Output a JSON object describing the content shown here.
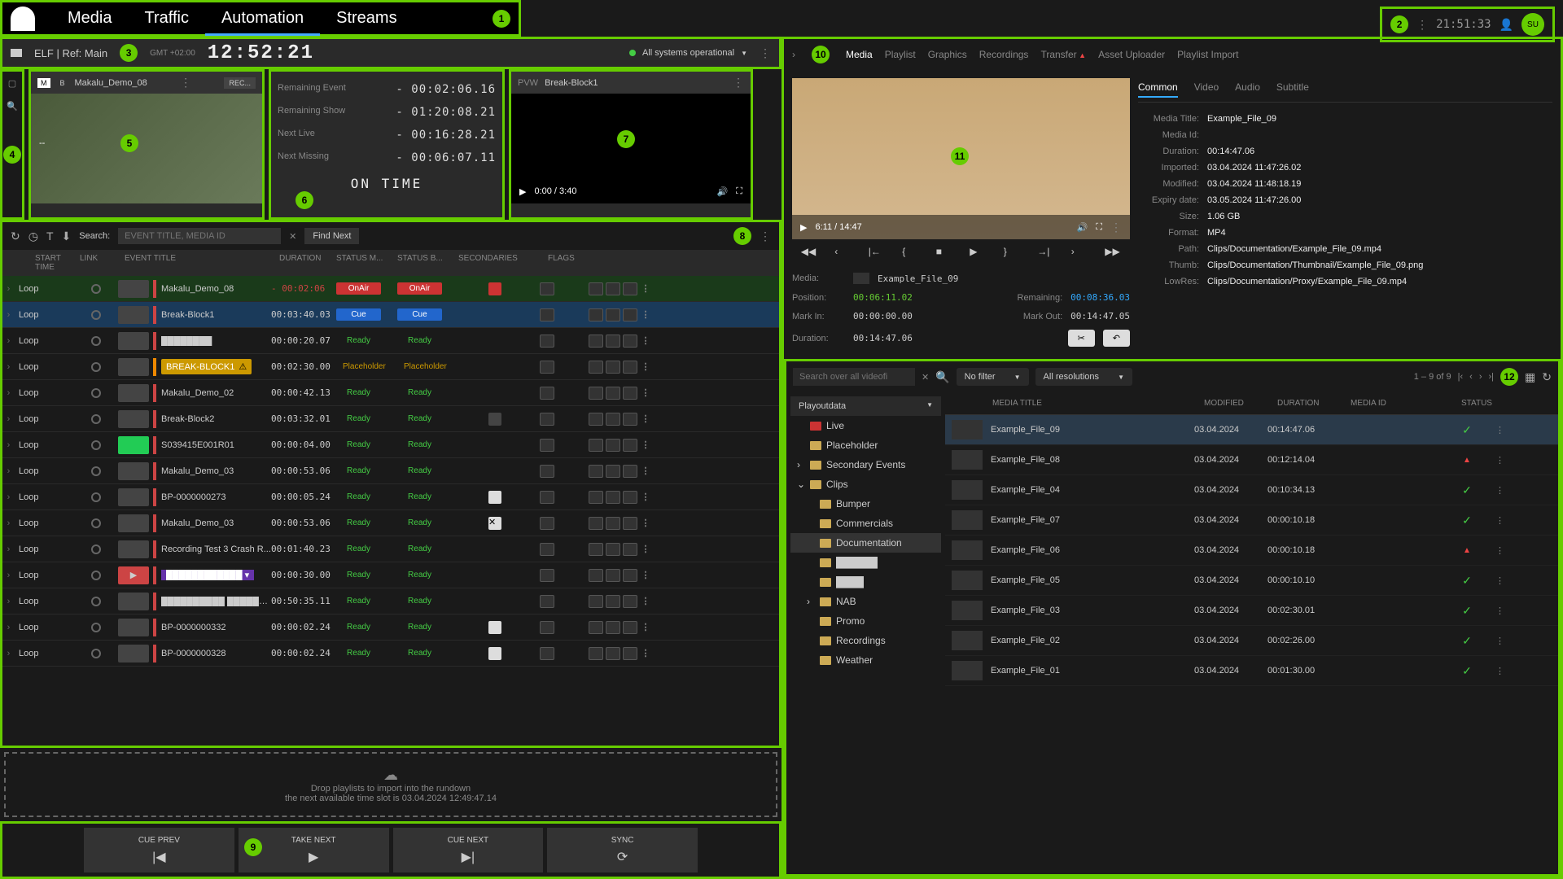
{
  "nav": {
    "items": [
      "Media",
      "Traffic",
      "Automation",
      "Streams"
    ],
    "active": 2
  },
  "topRight": {
    "time": "21:51:33",
    "avatar": "SU"
  },
  "statusBar": {
    "channel": "ELF | Ref: Main",
    "tz": "GMT +02:00",
    "clock": "12:52:21",
    "systemStatus": "All systems operational"
  },
  "pgm": {
    "badge1": "M",
    "badge2": "B",
    "title": "Makalu_Demo_08",
    "rec": "REC..."
  },
  "timing": {
    "rows": [
      {
        "label": "Remaining Event",
        "val": "- 00:02:06.16"
      },
      {
        "label": "Remaining Show",
        "val": "- 01:20:08.21"
      },
      {
        "label": "Next Live",
        "val": "- 00:16:28.21"
      },
      {
        "label": "Next Missing",
        "val": "- 00:06:07.11"
      }
    ],
    "onTime": "ON TIME"
  },
  "pvw": {
    "label": "PVW",
    "title": "Break-Block1",
    "time": "0:00 / 3:40"
  },
  "rundown": {
    "searchLabel": "Search:",
    "searchPlaceholder": "EVENT TITLE, MEDIA ID",
    "findNext": "Find Next",
    "headers": {
      "start": "START TIME",
      "link": "LINK",
      "title": "EVENT TITLE",
      "dur": "DURATION",
      "statusm": "STATUS M...",
      "statusb": "STATUS B...",
      "sec": "SECONDARIES",
      "flags": "FLAGS"
    },
    "rows": [
      {
        "start": "Loop",
        "title": "Makalu_Demo_08",
        "dur": "- 00:02:06",
        "m": "OnAir",
        "b": "OnAir",
        "state": "onair",
        "secRed": true
      },
      {
        "start": "Loop",
        "title": "Break-Block1",
        "dur": "00:03:40.03",
        "m": "Cue",
        "b": "Cue",
        "state": "cue"
      },
      {
        "start": "Loop",
        "title": "████████",
        "dur": "00:00:20.07",
        "m": "Ready",
        "b": "Ready",
        "state": ""
      },
      {
        "start": "Loop",
        "title": "BREAK-BLOCK1",
        "dur": "00:02:30.00",
        "m": "Placeholder",
        "b": "Placeholder",
        "state": "placeholder",
        "warn": true
      },
      {
        "start": "Loop",
        "title": "Makalu_Demo_02",
        "dur": "00:00:42.13",
        "m": "Ready",
        "b": "Ready",
        "state": ""
      },
      {
        "start": "Loop",
        "title": "Break-Block2",
        "dur": "00:03:32.01",
        "m": "Ready",
        "b": "Ready",
        "state": "",
        "secIcon": true
      },
      {
        "start": "Loop",
        "title": "S039415E001R01",
        "dur": "00:00:04.00",
        "m": "Ready",
        "b": "Ready",
        "state": "",
        "greenThumb": true
      },
      {
        "start": "Loop",
        "title": "Makalu_Demo_03",
        "dur": "00:00:53.06",
        "m": "Ready",
        "b": "Ready",
        "state": ""
      },
      {
        "start": "Loop",
        "title": "BP-0000000273",
        "dur": "00:00:05.24",
        "m": "Ready",
        "b": "Ready",
        "state": "",
        "flagDoc": true
      },
      {
        "start": "Loop",
        "title": "Makalu_Demo_03",
        "dur": "00:00:53.06",
        "m": "Ready",
        "b": "Ready",
        "state": "",
        "secClose": true
      },
      {
        "start": "Loop",
        "title": "Recording Test 3 Crash R...",
        "dur": "00:01:40.23",
        "m": "Ready",
        "b": "Ready",
        "state": ""
      },
      {
        "start": "Loop",
        "title": "████████████",
        "dur": "00:00:30.00",
        "m": "Ready",
        "b": "Ready",
        "state": "",
        "purple": true,
        "redThumb": true
      },
      {
        "start": "Loop",
        "title": "██████████ ████████",
        "dur": "00:50:35.11",
        "m": "Ready",
        "b": "Ready",
        "state": ""
      },
      {
        "start": "Loop",
        "title": "BP-0000000332",
        "dur": "00:00:02.24",
        "m": "Ready",
        "b": "Ready",
        "state": "",
        "flagDoc": true
      },
      {
        "start": "Loop",
        "title": "BP-0000000328",
        "dur": "00:00:02.24",
        "m": "Ready",
        "b": "Ready",
        "state": "",
        "flagDoc": true
      }
    ]
  },
  "dropZone": {
    "line1": "Drop playlists to import into the rundown",
    "line2": "the next available time slot is 03.04.2024 12:49:47.14"
  },
  "controls": {
    "cuePrev": "CUE PREV",
    "takeNext": "TAKE NEXT",
    "cueNext": "CUE NEXT",
    "sync": "SYNC"
  },
  "rightTabs": [
    "Media",
    "Playlist",
    "Graphics",
    "Recordings",
    "Transfer",
    "Asset Uploader",
    "Playlist Import"
  ],
  "metaTabs": [
    "Common",
    "Video",
    "Audio",
    "Subtitle"
  ],
  "preview": {
    "time": "6:11 / 14:47",
    "mediaLabel": "Media:",
    "mediaName": "Example_File_09",
    "posLabel": "Position:",
    "position": "00:06:11.02",
    "remLabel": "Remaining:",
    "remaining": "00:08:36.03",
    "markInLabel": "Mark In:",
    "markIn": "00:00:00.00",
    "markOutLabel": "Mark Out:",
    "markOut": "00:14:47.05",
    "durLabel": "Duration:",
    "duration": "00:14:47.06"
  },
  "metadata": [
    {
      "label": "Media Title:",
      "val": "Example_File_09"
    },
    {
      "label": "Media Id:",
      "val": ""
    },
    {
      "label": "Duration:",
      "val": "00:14:47.06"
    },
    {
      "label": "Imported:",
      "val": "03.04.2024 11:47:26.02"
    },
    {
      "label": "Modified:",
      "val": "03.04.2024 11:48:18.19"
    },
    {
      "label": "Expiry date:",
      "val": "03.05.2024 11:47:26.00"
    },
    {
      "label": "Size:",
      "val": "1.06 GB"
    },
    {
      "label": "Format:",
      "val": "MP4"
    },
    {
      "label": "Path:",
      "val": "Clips/Documentation/Example_File_09.mp4"
    },
    {
      "label": "Thumb:",
      "val": "Clips/Documentation/Thumbnail/Example_File_09.png"
    },
    {
      "label": "LowRes:",
      "val": "Clips/Documentation/Proxy/Example_File_09.mp4"
    }
  ],
  "browser": {
    "searchPlaceholder": "Search over all videofi",
    "filter1": "No filter",
    "filter2": "All resolutions",
    "pagination": "1 – 9 of 9",
    "treeHeader": "Playoutdata",
    "tree": [
      {
        "label": "Live",
        "depth": 0,
        "live": true
      },
      {
        "label": "Placeholder",
        "depth": 0
      },
      {
        "label": "Secondary Events",
        "depth": 0,
        "expand": true
      },
      {
        "label": "Clips",
        "depth": 0,
        "expand": true,
        "open": true
      },
      {
        "label": "Bumper",
        "depth": 1
      },
      {
        "label": "Commercials",
        "depth": 1
      },
      {
        "label": "Documentation",
        "depth": 1,
        "selected": true
      },
      {
        "label": "██████",
        "depth": 1
      },
      {
        "label": "████",
        "depth": 1
      },
      {
        "label": "NAB",
        "depth": 1,
        "expand": true
      },
      {
        "label": "Promo",
        "depth": 1
      },
      {
        "label": "Recordings",
        "depth": 1
      },
      {
        "label": "Weather",
        "depth": 1
      }
    ],
    "headers": {
      "title": "MEDIA TITLE",
      "mod": "MODIFIED",
      "dur": "DURATION",
      "id": "MEDIA ID",
      "status": "STATUS"
    },
    "files": [
      {
        "title": "Example_File_09",
        "mod": "03.04.2024",
        "dur": "00:14:47.06",
        "status": "ok",
        "selected": true
      },
      {
        "title": "Example_File_08",
        "mod": "03.04.2024",
        "dur": "00:12:14.04",
        "status": "warn"
      },
      {
        "title": "Example_File_04",
        "mod": "03.04.2024",
        "dur": "00:10:34.13",
        "status": "ok"
      },
      {
        "title": "Example_File_07",
        "mod": "03.04.2024",
        "dur": "00:00:10.18",
        "status": "ok"
      },
      {
        "title": "Example_File_06",
        "mod": "03.04.2024",
        "dur": "00:00:10.18",
        "status": "warn"
      },
      {
        "title": "Example_File_05",
        "mod": "03.04.2024",
        "dur": "00:00:10.10",
        "status": "ok"
      },
      {
        "title": "Example_File_03",
        "mod": "03.04.2024",
        "dur": "00:02:30.01",
        "status": "ok"
      },
      {
        "title": "Example_File_02",
        "mod": "03.04.2024",
        "dur": "00:02:26.00",
        "status": "ok"
      },
      {
        "title": "Example_File_01",
        "mod": "03.04.2024",
        "dur": "00:01:30.00",
        "status": "ok"
      }
    ]
  },
  "callouts": {
    "c1": "1",
    "c2": "2",
    "c3": "3",
    "c4": "4",
    "c5": "5",
    "c6": "6",
    "c7": "7",
    "c8": "8",
    "c9": "9",
    "c10": "10",
    "c11": "11",
    "c12": "12"
  }
}
